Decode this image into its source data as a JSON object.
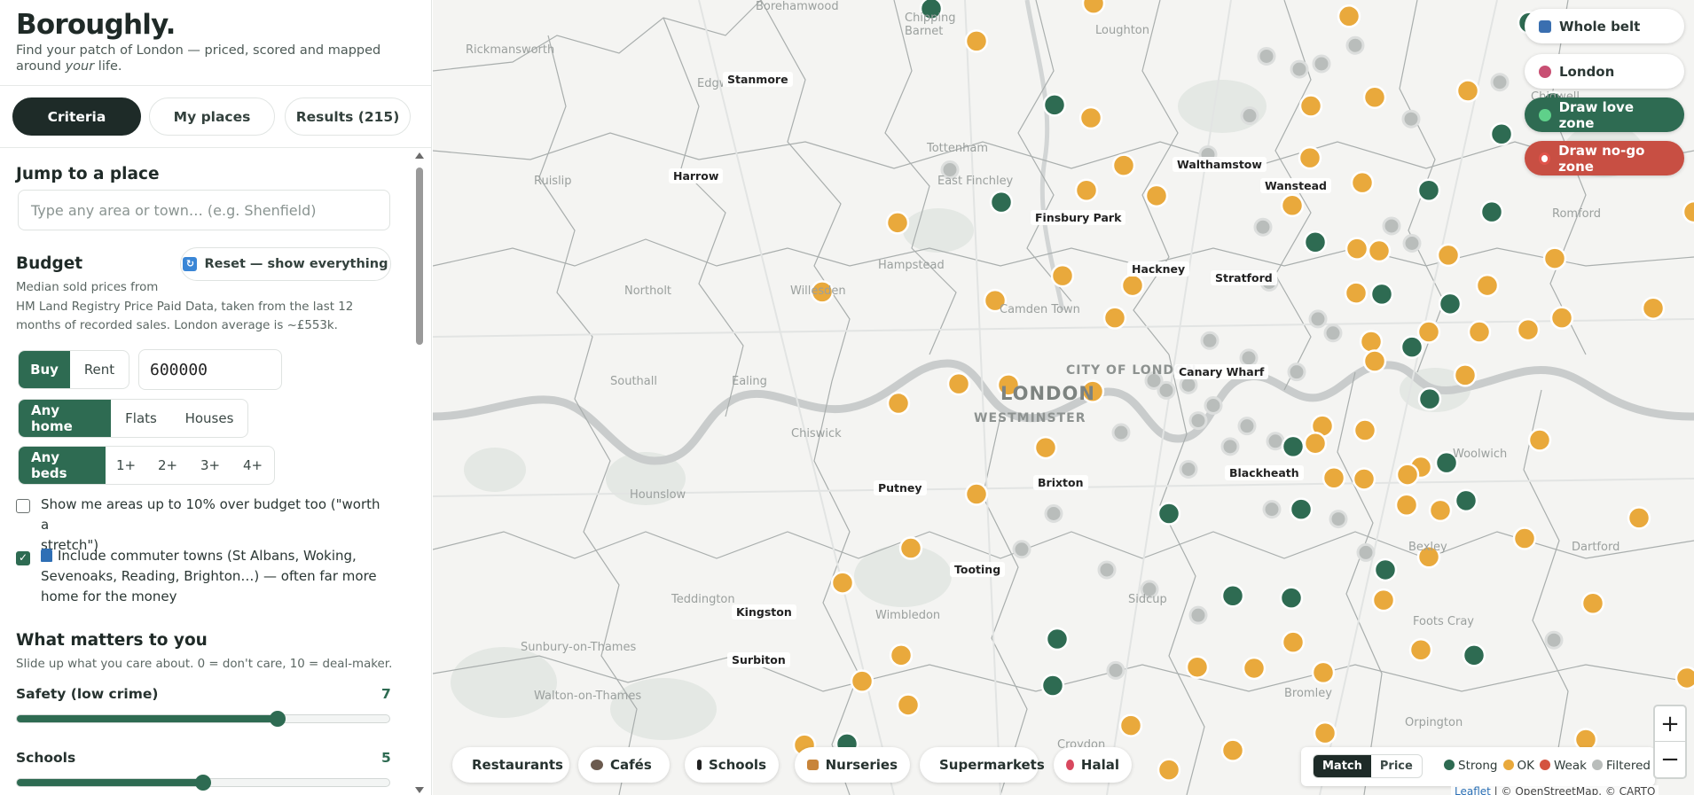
{
  "app": {
    "name": "Boroughly.",
    "tagline_pre": "Find your patch of London — priced, scored and mapped around ",
    "tagline_em": "your",
    "tagline_post": " life."
  },
  "tabs": [
    {
      "label": "Criteria",
      "active": true
    },
    {
      "label": "My places",
      "active": false
    },
    {
      "label": "Results (215)",
      "active": false
    }
  ],
  "jump": {
    "title": "Jump to a place",
    "placeholder": "Type any area or town… (e.g. Shenfield)"
  },
  "budget": {
    "title": "Budget",
    "reset_label": "Reset — show everything",
    "desc_1": "Median sold prices from",
    "desc_2": "HM Land Registry Price Paid Data, taken from the last 12",
    "desc_3": "months of recorded sales. London average is ~£553k.",
    "mode_options": [
      "Buy",
      "Rent"
    ],
    "mode_selected": "Buy",
    "price_value": "600000",
    "home_options": [
      "Any home",
      "Flats",
      "Houses"
    ],
    "home_selected": "Any home",
    "bed_options": [
      "Any beds",
      "1+",
      "2+",
      "3+",
      "4+"
    ],
    "bed_selected": "Any beds",
    "stretch_label_1": "Show me areas up to 10% over budget too (\"worth a",
    "stretch_label_2": "stretch\")",
    "stretch_checked": false,
    "commuter_label_1": "Include commuter towns (St Albans, Woking,",
    "commuter_label_2": "Sevenoaks, Reading, Brighton…) — often far more",
    "commuter_label_3": "home for the money",
    "commuter_checked": true
  },
  "matters": {
    "title": "What matters to you",
    "desc": "Slide up what you care about. 0 = don't care, 10 = deal-maker.",
    "sliders": [
      {
        "label": "Safety (low crime)",
        "value": 7,
        "max": 10
      },
      {
        "label": "Schools",
        "value": 5,
        "max": 10
      }
    ]
  },
  "map_controls": {
    "whole_belt": "Whole belt",
    "london": "London",
    "draw_love": "Draw love zone",
    "draw_nogo": "Draw no-go zone",
    "zoom_in": "+",
    "zoom_out": "−"
  },
  "chips": [
    {
      "label": "Restaurants",
      "icon": "restaurant-icon"
    },
    {
      "label": "Cafés",
      "icon": "cafe-icon"
    },
    {
      "label": "Schools",
      "icon": "school-icon"
    },
    {
      "label": "Nurseries",
      "icon": "nursery-icon"
    },
    {
      "label": "Supermarkets",
      "icon": "supermarket-icon"
    },
    {
      "label": "Halal",
      "icon": "halal-icon"
    }
  ],
  "legend": {
    "toggle": [
      "Match",
      "Price"
    ],
    "toggle_selected": "Match",
    "keys": [
      {
        "label": "Strong",
        "color": "#2e6b52"
      },
      {
        "label": "OK",
        "color": "#e9a93c"
      },
      {
        "label": "Weak",
        "color": "#d4533f"
      },
      {
        "label": "Filtered",
        "color": "#b9bdbb"
      }
    ]
  },
  "attribution": {
    "leaflet": "Leaflet",
    "rest": " | © OpenStreetMap, © CARTO"
  },
  "map_labels": {
    "place_tags": [
      "Stanmore",
      "Harrow",
      "Walthamstow",
      "Wanstead",
      "Finsbury Park",
      "Hackney",
      "Stratford",
      "Canary Wharf",
      "Blackheath",
      "Putney",
      "Brixton",
      "Tooting",
      "Kingston",
      "Surbiton"
    ],
    "base_places": [
      "Rickmansworth",
      "Borehamwood",
      "Chipping Barnet",
      "Loughton",
      "Edgware",
      "Tottenham",
      "East Finchley",
      "Ruislip",
      "Hampstead",
      "Northolt",
      "Willesden",
      "Camden Town",
      "Chigwell",
      "Romford",
      "Southall",
      "Ealing",
      "Chiswick",
      "Woolwich",
      "Hounslow",
      "Bexley",
      "Dartford",
      "Teddington",
      "Wimbledon",
      "Sidcup",
      "Foots Cray",
      "Sunbury-on-Thames",
      "Walton-on-Thames",
      "Bromley",
      "Croydon",
      "Orpington"
    ],
    "city": "LONDON",
    "city_of_london": "CITY OF LONDON",
    "westminster": "WESTMINSTER"
  },
  "colors": {
    "strong": "#2e6b52",
    "ok": "#e9a93c",
    "weak": "#d4533f",
    "filtered": "#b9bdbb",
    "accent_dark": "#1e2b28",
    "nogo": "#c84f43"
  },
  "markers": {
    "strong": [
      [
        562,
        8
      ],
      [
        1236,
        21
      ],
      [
        1263,
        95
      ],
      [
        701,
        97
      ],
      [
        1205,
        124
      ],
      [
        641,
        187
      ],
      [
        1123,
        176
      ],
      [
        1194,
        196
      ],
      [
        995,
        224
      ],
      [
        1070,
        272
      ],
      [
        1147,
        281
      ],
      [
        1104,
        321
      ],
      [
        1124,
        369
      ],
      [
        970,
        413
      ],
      [
        1143,
        428
      ],
      [
        979,
        471
      ],
      [
        1165,
        463
      ],
      [
        830,
        475
      ],
      [
        1074,
        527
      ],
      [
        902,
        551
      ],
      [
        968,
        553
      ],
      [
        704,
        591
      ],
      [
        1174,
        606
      ],
      [
        699,
        634
      ],
      [
        467,
        688
      ]
    ],
    "ok": [
      [
        745,
        3
      ],
      [
        1033,
        15
      ],
      [
        613,
        38
      ],
      [
        990,
        98
      ],
      [
        1062,
        90
      ],
      [
        1167,
        84
      ],
      [
        742,
        109
      ],
      [
        989,
        146
      ],
      [
        779,
        153
      ],
      [
        1048,
        169
      ],
      [
        737,
        176
      ],
      [
        816,
        181
      ],
      [
        969,
        190
      ],
      [
        1422,
        196
      ],
      [
        524,
        206
      ],
      [
        1042,
        230
      ],
      [
        1067,
        232
      ],
      [
        1145,
        236
      ],
      [
        1265,
        239
      ],
      [
        1481,
        245
      ],
      [
        1528,
        239
      ],
      [
        710,
        255
      ],
      [
        789,
        264
      ],
      [
        1189,
        264
      ],
      [
        1041,
        271
      ],
      [
        634,
        278
      ],
      [
        439,
        270
      ],
      [
        1376,
        285
      ],
      [
        1273,
        294
      ],
      [
        769,
        294
      ],
      [
        1123,
        307
      ],
      [
        1180,
        307
      ],
      [
        1235,
        305
      ],
      [
        1058,
        316
      ],
      [
        1062,
        334
      ],
      [
        1164,
        347
      ],
      [
        593,
        355
      ],
      [
        649,
        356
      ],
      [
        744,
        362
      ],
      [
        525,
        373
      ],
      [
        1003,
        394
      ],
      [
        1051,
        398
      ],
      [
        995,
        410
      ],
      [
        691,
        414
      ],
      [
        1248,
        407
      ],
      [
        1114,
        432
      ],
      [
        1099,
        439
      ],
      [
        1016,
        442
      ],
      [
        1050,
        443
      ],
      [
        613,
        457
      ],
      [
        1136,
        472
      ],
      [
        1098,
        467
      ],
      [
        1360,
        479
      ],
      [
        1231,
        498
      ],
      [
        539,
        507
      ],
      [
        1123,
        515
      ],
      [
        1480,
        507
      ],
      [
        462,
        539
      ],
      [
        1072,
        555
      ],
      [
        1308,
        558
      ],
      [
        970,
        594
      ],
      [
        1114,
        601
      ],
      [
        528,
        606
      ],
      [
        862,
        617
      ],
      [
        926,
        618
      ],
      [
        1004,
        622
      ],
      [
        484,
        630
      ],
      [
        1414,
        627
      ],
      [
        536,
        652
      ],
      [
        787,
        671
      ],
      [
        1006,
        678
      ],
      [
        419,
        689
      ],
      [
        1300,
        684
      ],
      [
        902,
        694
      ],
      [
        830,
        712
      ]
    ],
    "filtered": [
      [
        583,
        157
      ],
      [
        874,
        143
      ],
      [
        921,
        107
      ],
      [
        936,
        210
      ],
      [
        977,
        64
      ],
      [
        1002,
        59
      ],
      [
        940,
        52
      ],
      [
        1040,
        42
      ],
      [
        1203,
        76
      ],
      [
        1103,
        110
      ],
      [
        1104,
        225
      ],
      [
        1081,
        209
      ],
      [
        943,
        261
      ],
      [
        998,
        295
      ],
      [
        920,
        331
      ],
      [
        852,
        356
      ],
      [
        827,
        361
      ],
      [
        876,
        315
      ],
      [
        974,
        344
      ],
      [
        1015,
        308
      ],
      [
        880,
        375
      ],
      [
        899,
        413
      ],
      [
        950,
        408
      ],
      [
        918,
        394
      ],
      [
        863,
        389
      ],
      [
        813,
        352
      ],
      [
        852,
        434
      ],
      [
        776,
        400
      ],
      [
        700,
        475
      ],
      [
        664,
        508
      ],
      [
        760,
        527
      ],
      [
        808,
        545
      ],
      [
        770,
        620
      ],
      [
        863,
        569
      ],
      [
        1052,
        511
      ],
      [
        1021,
        480
      ],
      [
        946,
        471
      ],
      [
        1264,
        592
      ],
      [
        1558,
        354
      ],
      [
        1558,
        367
      ]
    ]
  }
}
